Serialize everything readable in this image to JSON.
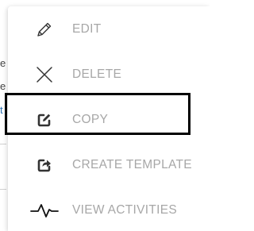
{
  "background": {
    "fragments": [
      "e",
      "e",
      "t"
    ]
  },
  "menu": {
    "items": [
      {
        "id": "edit",
        "label": "EDIT",
        "icon": "pencil-icon"
      },
      {
        "id": "delete",
        "label": "DELETE",
        "icon": "close-icon"
      },
      {
        "id": "copy",
        "label": "COPY",
        "icon": "copy-edit-icon",
        "highlighted": true
      },
      {
        "id": "create-template",
        "label": "CREATE TEMPLATE",
        "icon": "share-icon"
      },
      {
        "id": "view-activities",
        "label": "VIEW ACTIVITIES",
        "icon": "activity-icon"
      }
    ]
  },
  "colors": {
    "label": "#a7a7a7",
    "icon": "#333333",
    "highlight_border": "#000000"
  }
}
